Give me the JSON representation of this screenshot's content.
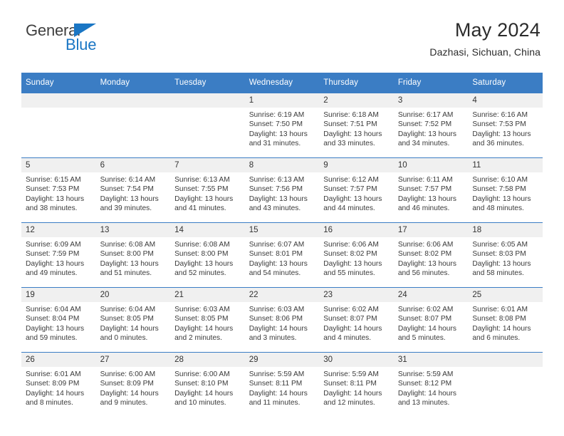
{
  "brand": {
    "name_top": "General",
    "name_bottom": "Blue",
    "triangle_color": "#1a76c4"
  },
  "header": {
    "title": "May 2024",
    "location": "Dazhasi, Sichuan, China"
  },
  "theme": {
    "header_blue": "#3b7dc4",
    "daynum_gray": "#f0f0f0",
    "text": "#3a3a3a"
  },
  "weekday_headers": [
    "Sunday",
    "Monday",
    "Tuesday",
    "Wednesday",
    "Thursday",
    "Friday",
    "Saturday"
  ],
  "weeks": [
    [
      {
        "day": "",
        "empty": true,
        "sunrise": "",
        "sunset": "",
        "daylight1": "",
        "daylight2": ""
      },
      {
        "day": "",
        "empty": true,
        "sunrise": "",
        "sunset": "",
        "daylight1": "",
        "daylight2": ""
      },
      {
        "day": "",
        "empty": true,
        "sunrise": "",
        "sunset": "",
        "daylight1": "",
        "daylight2": ""
      },
      {
        "day": "1",
        "empty": false,
        "sunrise": "Sunrise: 6:19 AM",
        "sunset": "Sunset: 7:50 PM",
        "daylight1": "Daylight: 13 hours",
        "daylight2": "and 31 minutes."
      },
      {
        "day": "2",
        "empty": false,
        "sunrise": "Sunrise: 6:18 AM",
        "sunset": "Sunset: 7:51 PM",
        "daylight1": "Daylight: 13 hours",
        "daylight2": "and 33 minutes."
      },
      {
        "day": "3",
        "empty": false,
        "sunrise": "Sunrise: 6:17 AM",
        "sunset": "Sunset: 7:52 PM",
        "daylight1": "Daylight: 13 hours",
        "daylight2": "and 34 minutes."
      },
      {
        "day": "4",
        "empty": false,
        "sunrise": "Sunrise: 6:16 AM",
        "sunset": "Sunset: 7:53 PM",
        "daylight1": "Daylight: 13 hours",
        "daylight2": "and 36 minutes."
      }
    ],
    [
      {
        "day": "5",
        "empty": false,
        "sunrise": "Sunrise: 6:15 AM",
        "sunset": "Sunset: 7:53 PM",
        "daylight1": "Daylight: 13 hours",
        "daylight2": "and 38 minutes."
      },
      {
        "day": "6",
        "empty": false,
        "sunrise": "Sunrise: 6:14 AM",
        "sunset": "Sunset: 7:54 PM",
        "daylight1": "Daylight: 13 hours",
        "daylight2": "and 39 minutes."
      },
      {
        "day": "7",
        "empty": false,
        "sunrise": "Sunrise: 6:13 AM",
        "sunset": "Sunset: 7:55 PM",
        "daylight1": "Daylight: 13 hours",
        "daylight2": "and 41 minutes."
      },
      {
        "day": "8",
        "empty": false,
        "sunrise": "Sunrise: 6:13 AM",
        "sunset": "Sunset: 7:56 PM",
        "daylight1": "Daylight: 13 hours",
        "daylight2": "and 43 minutes."
      },
      {
        "day": "9",
        "empty": false,
        "sunrise": "Sunrise: 6:12 AM",
        "sunset": "Sunset: 7:57 PM",
        "daylight1": "Daylight: 13 hours",
        "daylight2": "and 44 minutes."
      },
      {
        "day": "10",
        "empty": false,
        "sunrise": "Sunrise: 6:11 AM",
        "sunset": "Sunset: 7:57 PM",
        "daylight1": "Daylight: 13 hours",
        "daylight2": "and 46 minutes."
      },
      {
        "day": "11",
        "empty": false,
        "sunrise": "Sunrise: 6:10 AM",
        "sunset": "Sunset: 7:58 PM",
        "daylight1": "Daylight: 13 hours",
        "daylight2": "and 48 minutes."
      }
    ],
    [
      {
        "day": "12",
        "empty": false,
        "sunrise": "Sunrise: 6:09 AM",
        "sunset": "Sunset: 7:59 PM",
        "daylight1": "Daylight: 13 hours",
        "daylight2": "and 49 minutes."
      },
      {
        "day": "13",
        "empty": false,
        "sunrise": "Sunrise: 6:08 AM",
        "sunset": "Sunset: 8:00 PM",
        "daylight1": "Daylight: 13 hours",
        "daylight2": "and 51 minutes."
      },
      {
        "day": "14",
        "empty": false,
        "sunrise": "Sunrise: 6:08 AM",
        "sunset": "Sunset: 8:00 PM",
        "daylight1": "Daylight: 13 hours",
        "daylight2": "and 52 minutes."
      },
      {
        "day": "15",
        "empty": false,
        "sunrise": "Sunrise: 6:07 AM",
        "sunset": "Sunset: 8:01 PM",
        "daylight1": "Daylight: 13 hours",
        "daylight2": "and 54 minutes."
      },
      {
        "day": "16",
        "empty": false,
        "sunrise": "Sunrise: 6:06 AM",
        "sunset": "Sunset: 8:02 PM",
        "daylight1": "Daylight: 13 hours",
        "daylight2": "and 55 minutes."
      },
      {
        "day": "17",
        "empty": false,
        "sunrise": "Sunrise: 6:06 AM",
        "sunset": "Sunset: 8:02 PM",
        "daylight1": "Daylight: 13 hours",
        "daylight2": "and 56 minutes."
      },
      {
        "day": "18",
        "empty": false,
        "sunrise": "Sunrise: 6:05 AM",
        "sunset": "Sunset: 8:03 PM",
        "daylight1": "Daylight: 13 hours",
        "daylight2": "and 58 minutes."
      }
    ],
    [
      {
        "day": "19",
        "empty": false,
        "sunrise": "Sunrise: 6:04 AM",
        "sunset": "Sunset: 8:04 PM",
        "daylight1": "Daylight: 13 hours",
        "daylight2": "and 59 minutes."
      },
      {
        "day": "20",
        "empty": false,
        "sunrise": "Sunrise: 6:04 AM",
        "sunset": "Sunset: 8:05 PM",
        "daylight1": "Daylight: 14 hours",
        "daylight2": "and 0 minutes."
      },
      {
        "day": "21",
        "empty": false,
        "sunrise": "Sunrise: 6:03 AM",
        "sunset": "Sunset: 8:05 PM",
        "daylight1": "Daylight: 14 hours",
        "daylight2": "and 2 minutes."
      },
      {
        "day": "22",
        "empty": false,
        "sunrise": "Sunrise: 6:03 AM",
        "sunset": "Sunset: 8:06 PM",
        "daylight1": "Daylight: 14 hours",
        "daylight2": "and 3 minutes."
      },
      {
        "day": "23",
        "empty": false,
        "sunrise": "Sunrise: 6:02 AM",
        "sunset": "Sunset: 8:07 PM",
        "daylight1": "Daylight: 14 hours",
        "daylight2": "and 4 minutes."
      },
      {
        "day": "24",
        "empty": false,
        "sunrise": "Sunrise: 6:02 AM",
        "sunset": "Sunset: 8:07 PM",
        "daylight1": "Daylight: 14 hours",
        "daylight2": "and 5 minutes."
      },
      {
        "day": "25",
        "empty": false,
        "sunrise": "Sunrise: 6:01 AM",
        "sunset": "Sunset: 8:08 PM",
        "daylight1": "Daylight: 14 hours",
        "daylight2": "and 6 minutes."
      }
    ],
    [
      {
        "day": "26",
        "empty": false,
        "sunrise": "Sunrise: 6:01 AM",
        "sunset": "Sunset: 8:09 PM",
        "daylight1": "Daylight: 14 hours",
        "daylight2": "and 8 minutes."
      },
      {
        "day": "27",
        "empty": false,
        "sunrise": "Sunrise: 6:00 AM",
        "sunset": "Sunset: 8:09 PM",
        "daylight1": "Daylight: 14 hours",
        "daylight2": "and 9 minutes."
      },
      {
        "day": "28",
        "empty": false,
        "sunrise": "Sunrise: 6:00 AM",
        "sunset": "Sunset: 8:10 PM",
        "daylight1": "Daylight: 14 hours",
        "daylight2": "and 10 minutes."
      },
      {
        "day": "29",
        "empty": false,
        "sunrise": "Sunrise: 5:59 AM",
        "sunset": "Sunset: 8:11 PM",
        "daylight1": "Daylight: 14 hours",
        "daylight2": "and 11 minutes."
      },
      {
        "day": "30",
        "empty": false,
        "sunrise": "Sunrise: 5:59 AM",
        "sunset": "Sunset: 8:11 PM",
        "daylight1": "Daylight: 14 hours",
        "daylight2": "and 12 minutes."
      },
      {
        "day": "31",
        "empty": false,
        "sunrise": "Sunrise: 5:59 AM",
        "sunset": "Sunset: 8:12 PM",
        "daylight1": "Daylight: 14 hours",
        "daylight2": "and 13 minutes."
      },
      {
        "day": "",
        "empty": true,
        "sunrise": "",
        "sunset": "",
        "daylight1": "",
        "daylight2": ""
      }
    ]
  ]
}
